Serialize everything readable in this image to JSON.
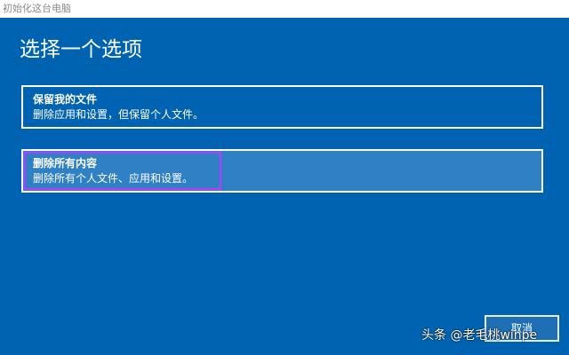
{
  "window": {
    "title": "初始化这台电脑"
  },
  "page": {
    "heading": "选择一个选项"
  },
  "options": [
    {
      "title": "保留我的文件",
      "description": "删除应用和设置，但保留个人文件。"
    },
    {
      "title": "删除所有内容",
      "description": "删除所有个人文件、应用和设置。"
    }
  ],
  "buttons": {
    "cancel": "取消"
  },
  "watermark": {
    "text": "头条 @老毛桃winpe"
  },
  "colors": {
    "background": "#0063b1",
    "selected_option": "#2f80c4",
    "highlight_frame": "#b63bff",
    "text": "#ffffff"
  }
}
